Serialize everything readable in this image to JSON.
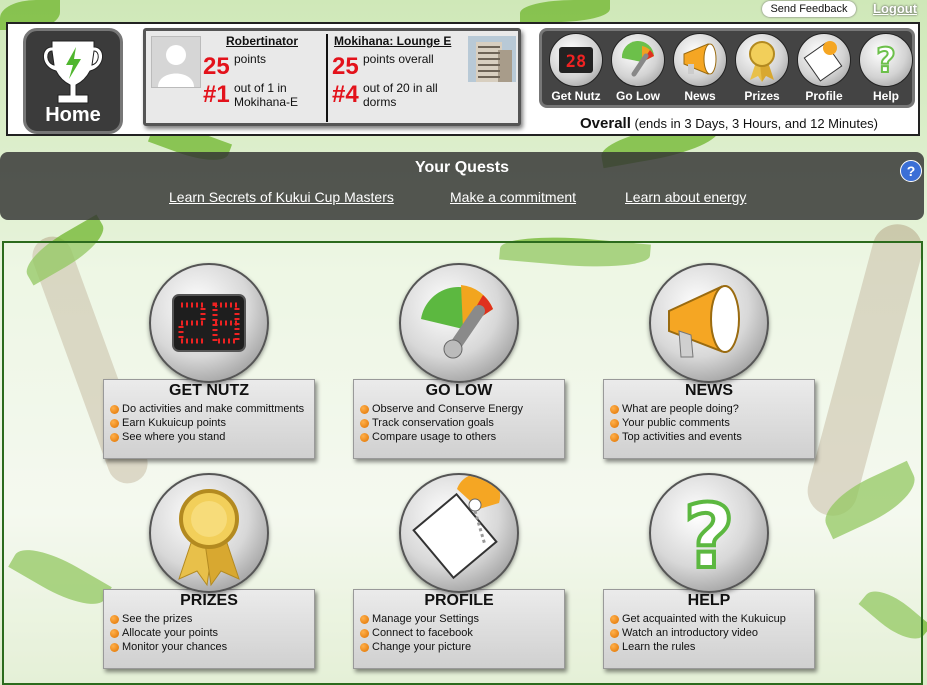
{
  "topbar": {
    "feedback_label": "Send Feedback",
    "logout_label": "Logout"
  },
  "home": {
    "label": "Home"
  },
  "player": {
    "name": "Robertinator",
    "points": "25",
    "points_label": "points",
    "rank": "#1",
    "rank_text": "out of 1 in Mokihana-E"
  },
  "team": {
    "name": "Mokihana: Lounge E",
    "points": "25",
    "points_label": "points overall",
    "rank": "#4",
    "rank_text": "out of 20 in all dorms"
  },
  "nav": [
    {
      "label": "Get Nutz",
      "icon": "scoreboard-icon"
    },
    {
      "label": "Go Low",
      "icon": "gauge-icon"
    },
    {
      "label": "News",
      "icon": "megaphone-icon"
    },
    {
      "label": "Prizes",
      "icon": "ribbon-icon"
    },
    {
      "label": "Profile",
      "icon": "profile-card-icon"
    },
    {
      "label": "Help",
      "icon": "question-mark-icon"
    }
  ],
  "nav_score_display": "28",
  "overall": {
    "label": "Overall",
    "detail": "(ends in 3 Days, 3 Hours, and 12 Minutes)"
  },
  "quests": {
    "title": "Your Quests",
    "links": [
      "Learn Secrets of Kukui Cup Masters",
      "Make a commitment",
      "Learn about energy"
    ],
    "help": "?"
  },
  "tiles": [
    {
      "title": "GET NUTZ",
      "icon": "scoreboard-icon",
      "items": [
        "Do activities and make committments",
        "Earn Kukuicup points",
        "See where you stand"
      ]
    },
    {
      "title": "GO LOW",
      "icon": "gauge-icon",
      "items": [
        "Observe and Conserve Energy",
        "Track conservation goals",
        "Compare usage to others"
      ]
    },
    {
      "title": "NEWS",
      "icon": "megaphone-icon",
      "items": [
        "What are people doing?",
        "Your public comments",
        "Top activities and events"
      ]
    },
    {
      "title": "PRIZES",
      "icon": "ribbon-icon",
      "items": [
        "See the prizes",
        "Allocate your points",
        "Monitor your chances"
      ]
    },
    {
      "title": "PROFILE",
      "icon": "profile-card-icon",
      "items": [
        "Manage your Settings",
        "Connect to facebook",
        "Change your picture"
      ]
    },
    {
      "title": "HELP",
      "icon": "question-mark-icon",
      "items": [
        "Get acquainted with the Kukuicup",
        "Watch an introductory video",
        "Learn the rules"
      ]
    }
  ],
  "colors": {
    "accent_red": "#e3121b",
    "bullet_orange": "#e07200",
    "leaf_green": "#6fb52c"
  }
}
